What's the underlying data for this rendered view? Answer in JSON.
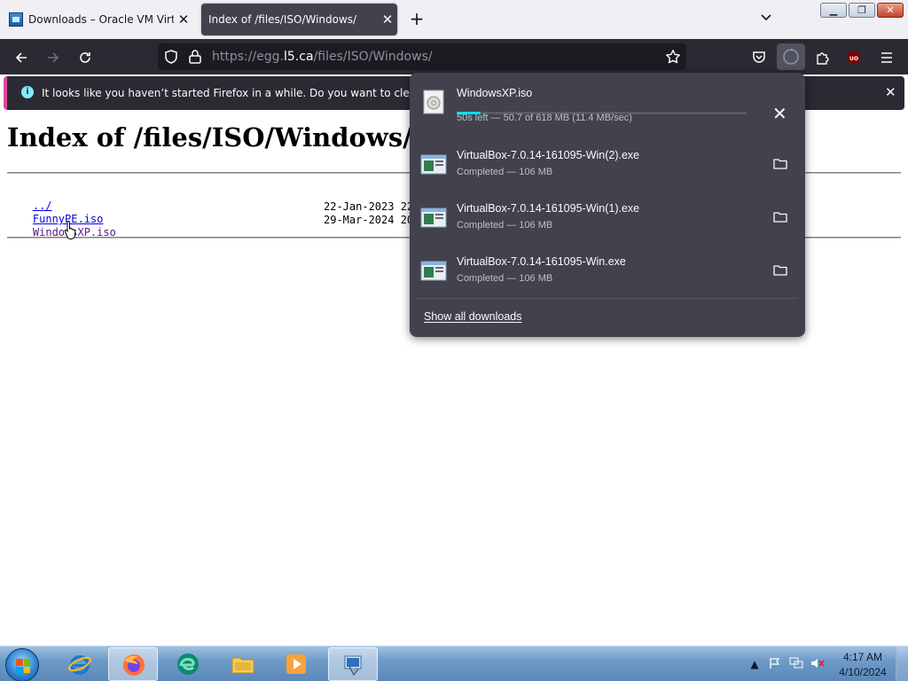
{
  "browser": {
    "tabs": [
      {
        "title": "Downloads – Oracle VM VirtualBox",
        "active": false
      },
      {
        "title": "Index of /files/ISO/Windows/",
        "active": true
      }
    ],
    "url": {
      "prefix": "https://egg.",
      "host": "l5.ca",
      "path": "/files/ISO/Windows/"
    },
    "notification": {
      "text": "It looks like you haven’t started Firefox in a while. Do you want to clean it up for"
    }
  },
  "page": {
    "title": "Index of /files/ISO/Windows/",
    "listing": [
      {
        "name": "../",
        "date": ""
      },
      {
        "name": "FunnyPE.iso",
        "date": "22-Jan-2023 22"
      },
      {
        "name": "WindowsXP.iso",
        "date": "29-Mar-2024 20"
      }
    ]
  },
  "downloads": {
    "items": [
      {
        "name": "WindowsXP.iso",
        "status": "50s left — 50.7 of 618 MB (11.4 MB/sec)",
        "progress": 0.082,
        "in_progress": true
      },
      {
        "name": "VirtualBox-7.0.14-161095-Win(2).exe",
        "status": "Completed — 106 MB"
      },
      {
        "name": "VirtualBox-7.0.14-161095-Win(1).exe",
        "status": "Completed — 106 MB"
      },
      {
        "name": "VirtualBox-7.0.14-161095-Win.exe",
        "status": "Completed — 106 MB"
      }
    ],
    "show_all_label": "Show all downloads"
  },
  "taskbar": {
    "apps": [
      "internet-explorer",
      "firefox",
      "edge",
      "file-explorer",
      "media-player",
      "virtualbox-installer"
    ],
    "time": "4:17 AM",
    "date": "4/10/2024"
  },
  "colors": {
    "accent": "#00ddff",
    "toolbar": "#2b2a33",
    "panel": "#42414d",
    "notification_bar": "#e0479e"
  }
}
